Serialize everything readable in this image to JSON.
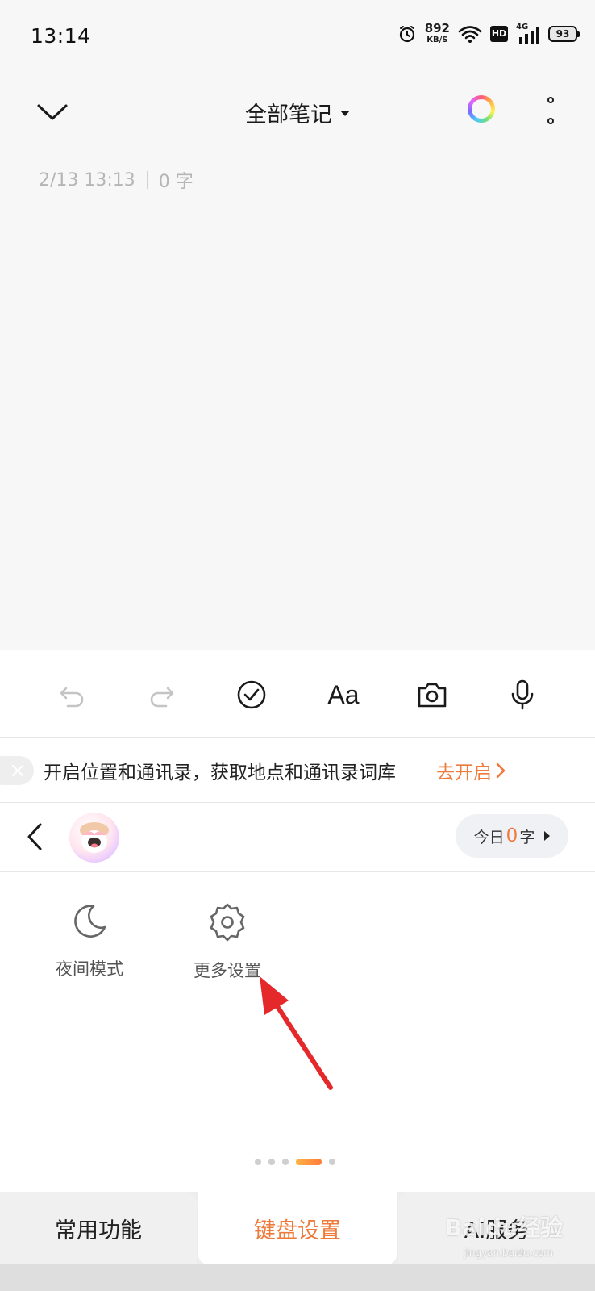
{
  "status_bar": {
    "time": "13:14",
    "net_speed_value": "892",
    "net_speed_unit": "KB/S",
    "hd_badge": "HD",
    "signal_label": "4G",
    "battery": "93",
    "icons": [
      "alarm-icon",
      "wifi-icon",
      "signal-icon",
      "battery-icon"
    ]
  },
  "header": {
    "title": "全部笔记",
    "collapse_icon": "chevron-down-icon",
    "color_icon": "color-ring-icon",
    "more_icon": "more-vertical-icon"
  },
  "note": {
    "timestamp": "2/13 13:13",
    "word_count": "0 字"
  },
  "toolbar": {
    "items": [
      "undo-icon",
      "redo-icon",
      "checklist-icon",
      "font-format-icon",
      "camera-icon",
      "microphone-icon"
    ],
    "font_label": "Aa"
  },
  "permission_bar": {
    "text": "开启位置和通讯录，获取地点和通讯录词库",
    "link_label": "去开启"
  },
  "keyboard_header": {
    "today_prefix": "今日",
    "today_count": "0",
    "today_suffix": "字"
  },
  "features": [
    {
      "label": "夜间模式",
      "icon": "moon-icon"
    },
    {
      "label": "更多设置",
      "icon": "gear-icon"
    }
  ],
  "pager": {
    "count": 5,
    "active_index": 3
  },
  "tabs": [
    {
      "label": "常用功能",
      "active": false
    },
    {
      "label": "键盘设置",
      "active": true
    },
    {
      "label": "AI服务",
      "active": false
    }
  ],
  "watermark": {
    "text": "Baidu经验",
    "sub": "jingyan.baidu.com"
  },
  "colors": {
    "accent": "#ee7a3c",
    "annotation_arrow": "#e5282a",
    "background": "#f7f7f8"
  }
}
